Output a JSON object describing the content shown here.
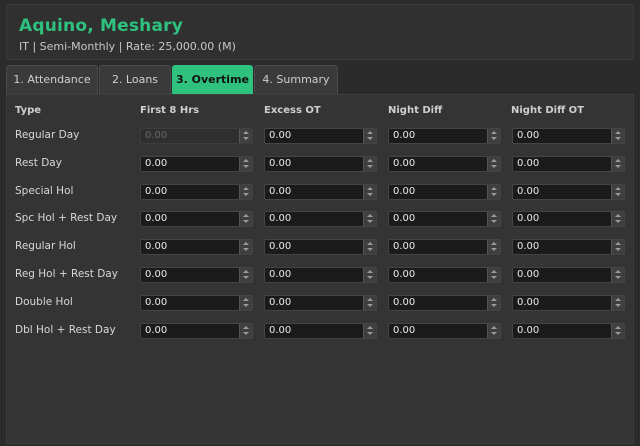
{
  "employee": {
    "name": "Aquino, Meshary",
    "meta": "IT | Semi-Monthly | Rate: 25,000.00 (M)"
  },
  "tabs": [
    {
      "label": "1. Attendance",
      "active": false
    },
    {
      "label": "2. Loans",
      "active": false
    },
    {
      "label": "3. Overtime",
      "active": true
    },
    {
      "label": "4. Summary",
      "active": false
    }
  ],
  "columns": [
    "Type",
    "First 8 Hrs",
    "Excess OT",
    "Night Diff",
    "Night Diff OT"
  ],
  "rows": [
    {
      "type": "Regular Day",
      "values": [
        "0.00",
        "0.00",
        "0.00",
        "0.00"
      ],
      "first_disabled": true
    },
    {
      "type": "Rest Day",
      "values": [
        "0.00",
        "0.00",
        "0.00",
        "0.00"
      ],
      "first_disabled": false
    },
    {
      "type": "Special Hol",
      "values": [
        "0.00",
        "0.00",
        "0.00",
        "0.00"
      ],
      "first_disabled": false
    },
    {
      "type": "Spc Hol + Rest Day",
      "values": [
        "0.00",
        "0.00",
        "0.00",
        "0.00"
      ],
      "first_disabled": false
    },
    {
      "type": "Regular Hol",
      "values": [
        "0.00",
        "0.00",
        "0.00",
        "0.00"
      ],
      "first_disabled": false
    },
    {
      "type": "Reg Hol + Rest Day",
      "values": [
        "0.00",
        "0.00",
        "0.00",
        "0.00"
      ],
      "first_disabled": false
    },
    {
      "type": "Double Hol",
      "values": [
        "0.00",
        "0.00",
        "0.00",
        "0.00"
      ],
      "first_disabled": false
    },
    {
      "type": "Dbl Hol + Rest Day",
      "values": [
        "0.00",
        "0.00",
        "0.00",
        "0.00"
      ],
      "first_disabled": false
    }
  ],
  "colors": {
    "accent": "#2ec27e",
    "background": "#2b2b2b",
    "field": "#1b1b1b"
  }
}
